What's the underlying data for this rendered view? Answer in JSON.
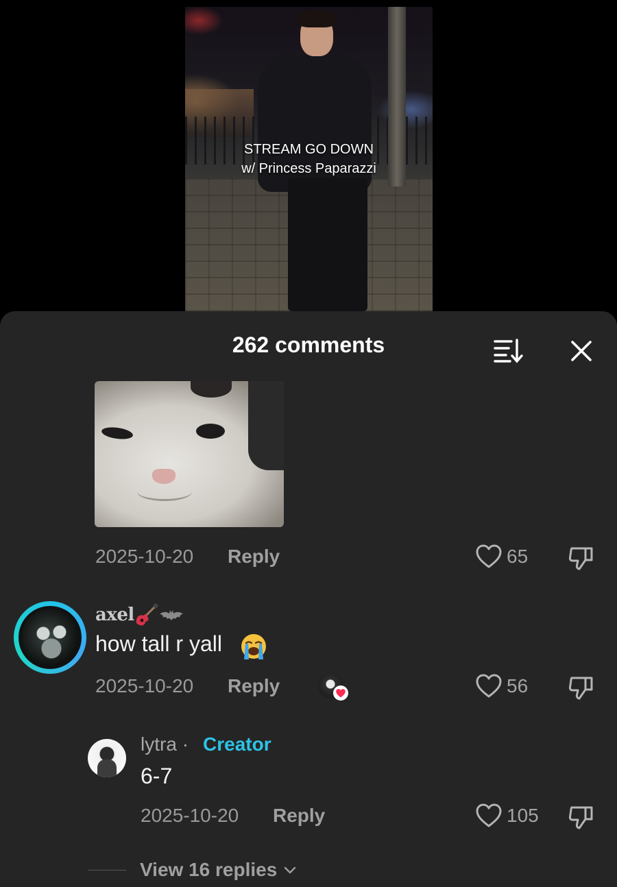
{
  "video": {
    "caption_line1": "STREAM GO DOWN",
    "caption_line2": "w/ Princess Paparazzi"
  },
  "sheet": {
    "title": "262 comments",
    "icons": {
      "sort": "sort-icon",
      "close": "close-icon"
    }
  },
  "comment_gif": {
    "media": "cat-reaction-gif",
    "date": "2025-10-20",
    "reply_label": "Reply",
    "likes": "65"
  },
  "comment_main": {
    "username": "axel",
    "badges": [
      "guitar-emoji",
      "bat-emoji"
    ],
    "text": "how tall r yall",
    "emoji": "loudly-crying-face",
    "date": "2025-10-20",
    "reply_label": "Reply",
    "likes": "56",
    "liked_by_creator": true
  },
  "reply": {
    "username": "lytra",
    "separator": "·",
    "role": "Creator",
    "text": "6-7",
    "date": "2025-10-20",
    "reply_label": "Reply",
    "likes": "105"
  },
  "view_replies": {
    "label": "View 16 replies"
  },
  "colors": {
    "sheet_bg": "#252525",
    "creator_accent": "#2cc3e6",
    "heart_red": "#fe2c55",
    "muted_text": "#9a9a9a"
  }
}
